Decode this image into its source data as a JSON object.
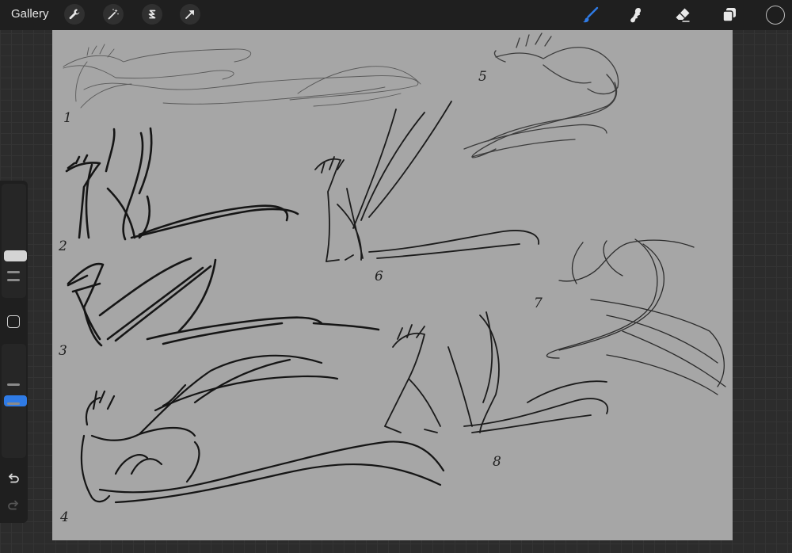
{
  "topbar": {
    "gallery_label": "Gallery",
    "left_tools": [
      "wrench-icon",
      "magic-wand-icon",
      "selection-icon",
      "transform-arrow-icon"
    ],
    "right_tools": [
      "brush-icon",
      "smudge-icon",
      "eraser-icon",
      "layers-icon"
    ],
    "active_tool": "brush",
    "accent_color": "#2f7be6",
    "current_color": "#1e1e1e"
  },
  "sidebar": {
    "brush_size_level": 0.35,
    "opacity_level": 0.5,
    "icons": [
      "modify-square-icon",
      "undo-icon",
      "redo-icon"
    ]
  },
  "canvas": {
    "background_color": "#a6a6a6",
    "sketch_labels": [
      "1",
      "2",
      "3",
      "4",
      "5",
      "6",
      "7",
      "8"
    ]
  }
}
